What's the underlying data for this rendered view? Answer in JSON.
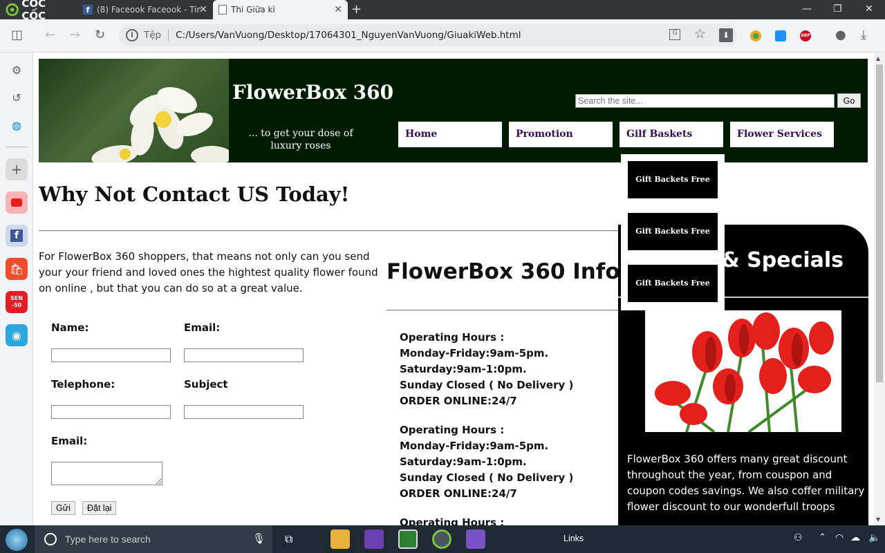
{
  "browser": {
    "brand": "CỐC CỐC",
    "tabs": [
      {
        "title": "(8) Faceook Faceook - Tim"
      },
      {
        "title": "Thi Giữa kì"
      }
    ],
    "address": {
      "scheme": "Tệp",
      "url": "C:/Users/VanVuong/Desktop/17064301_NguyenVanVuong/GiuakiWeb.html"
    },
    "colors": {
      "chrome_dark": "#323639",
      "toolbar": "#f1f3f4"
    }
  },
  "site": {
    "name": "FlowerBox 360",
    "tagline": "... to get your dose of luxury roses",
    "search_placeholder": "Search the site...",
    "search_button": "Go",
    "nav": [
      "Home",
      "Promotion",
      "Gilf Baskets",
      "Flower Services"
    ],
    "dropdown": [
      "Gift Backets Free",
      "Gift Backets Free",
      "Gift Backets Free"
    ],
    "colors": {
      "header_bg": "#001c00",
      "nav_text": "#3a0a58"
    }
  },
  "content": {
    "title": "Why Not Contact US Today!",
    "intro": "For FlowerBox 360 shoppers, that means not only can you send your your friend and loved ones the hightest quality flower found on online , but that you can do so at a great value.",
    "form": {
      "name_label": "Name:",
      "email_label": "Email:",
      "telephone_label": "Telephone:",
      "subject_label": "Subject",
      "message_label": "Email:",
      "submit": "Gửi",
      "reset": "Đặt lại"
    },
    "info": {
      "title": "FlowerBox 360 Info",
      "hours": [
        {
          "line1": "Operating Hours :",
          "line2": "Monday-Friday:9am-5pm.",
          "line3": "Saturday:9am-1:0pm.",
          "line4": "Sunday Closed ( No Delivery )",
          "line5": "ORDER ONLINE:24/7"
        },
        {
          "line1": "Operating Hours :",
          "line2": "Monday-Friday:9am-5pm.",
          "line3": "Saturday:9am-1:0pm.",
          "line4": "Sunday Closed ( No Delivery )",
          "line5": "ORDER ONLINE:24/7"
        },
        {
          "line1": "Operating Hours :"
        }
      ]
    },
    "aside": {
      "title": "r & Specials",
      "text": "FlowerBox 360 offers many great discount throughout the year, from couspon and coupon codes savings. We also coffer military flower discount to our wonderfull troops"
    }
  },
  "taskbar": {
    "search_placeholder": "Type here to search",
    "links_label": "Links"
  }
}
